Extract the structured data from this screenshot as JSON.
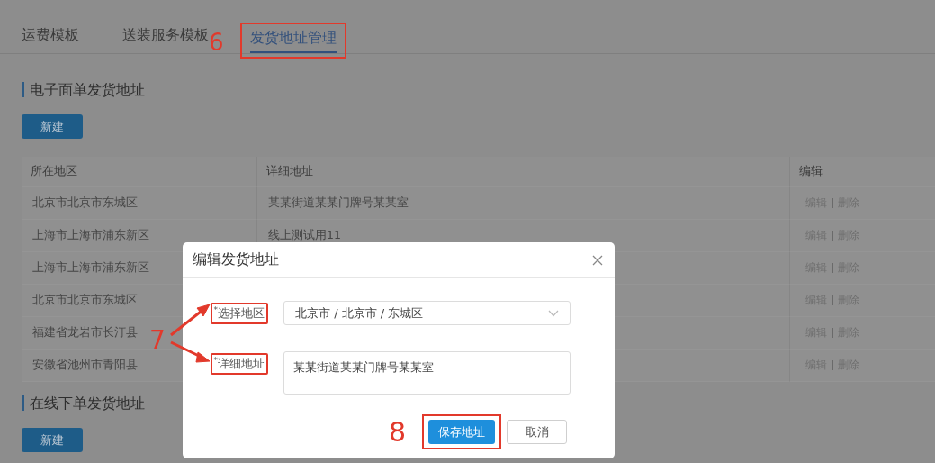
{
  "tabs": [
    {
      "label": "运费模板",
      "selected": false,
      "highlighted": false
    },
    {
      "label": "送装服务模板",
      "selected": false,
      "highlighted": false
    },
    {
      "label": "发货地址管理",
      "selected": true,
      "highlighted": true,
      "step": "6"
    }
  ],
  "sections": [
    {
      "title": "电子面单发货地址",
      "button": "新建",
      "table": {
        "columns": [
          "所在地区",
          "详细地址",
          "编辑"
        ],
        "rows": [
          {
            "region": "北京市北京市东城区",
            "detail": "某某街道某某门牌号某某室",
            "actions": [
              "编辑",
              "删除"
            ]
          },
          {
            "region": "上海市上海市浦东新区",
            "detail": "线上测试用11",
            "actions": [
              "编辑",
              "删除"
            ]
          },
          {
            "region": "上海市上海市浦东新区",
            "actions": [
              "编辑",
              "删除"
            ]
          },
          {
            "region": "北京市北京市东城区",
            "actions": [
              "编辑",
              "删除"
            ]
          },
          {
            "region": "福建省龙岩市长汀县",
            "actions": [
              "编辑",
              "删除"
            ]
          },
          {
            "region": "安徽省池州市青阳县",
            "actions": [
              "编辑",
              "删除"
            ]
          }
        ]
      }
    },
    {
      "title": "在线下单发货地址",
      "button": "新建"
    }
  ],
  "dialog": {
    "title": "编辑发货地址",
    "step": "7",
    "fields": [
      {
        "kind": "select",
        "label": "$^{*}$选择地区",
        "value": "北京市 / 北京市 / 东城区",
        "highlighted": true
      },
      {
        "kind": "textarea",
        "label": "$^{*}$详细地址",
        "value": "某某街道某某门牌号某某室",
        "highlighted": true
      }
    ],
    "buttons": [
      {
        "label": "保存地址",
        "primary": true,
        "highlighted": true,
        "step": "8"
      },
      {
        "label": "取消",
        "primary": false,
        "highlighted": false
      }
    ]
  }
}
